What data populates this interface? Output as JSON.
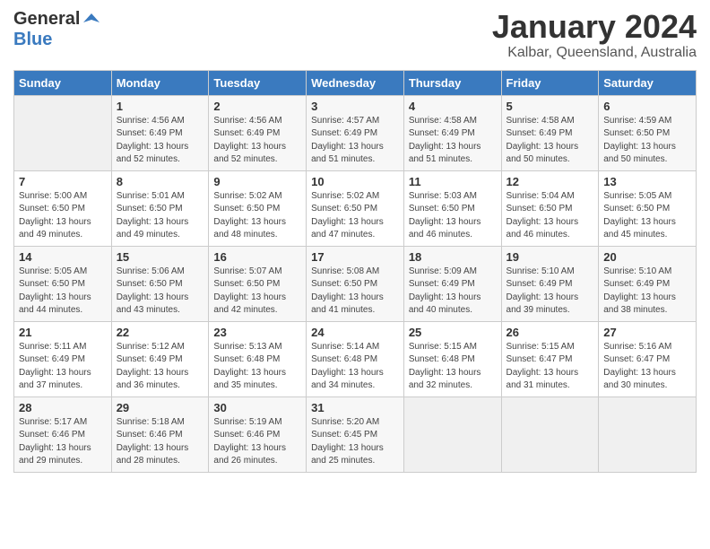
{
  "logo": {
    "general": "General",
    "blue": "Blue"
  },
  "title": "January 2024",
  "subtitle": "Kalbar, Queensland, Australia",
  "days_of_week": [
    "Sunday",
    "Monday",
    "Tuesday",
    "Wednesday",
    "Thursday",
    "Friday",
    "Saturday"
  ],
  "weeks": [
    [
      {
        "day": "",
        "detail": ""
      },
      {
        "day": "1",
        "detail": "Sunrise: 4:56 AM\nSunset: 6:49 PM\nDaylight: 13 hours\nand 52 minutes."
      },
      {
        "day": "2",
        "detail": "Sunrise: 4:56 AM\nSunset: 6:49 PM\nDaylight: 13 hours\nand 52 minutes."
      },
      {
        "day": "3",
        "detail": "Sunrise: 4:57 AM\nSunset: 6:49 PM\nDaylight: 13 hours\nand 51 minutes."
      },
      {
        "day": "4",
        "detail": "Sunrise: 4:58 AM\nSunset: 6:49 PM\nDaylight: 13 hours\nand 51 minutes."
      },
      {
        "day": "5",
        "detail": "Sunrise: 4:58 AM\nSunset: 6:49 PM\nDaylight: 13 hours\nand 50 minutes."
      },
      {
        "day": "6",
        "detail": "Sunrise: 4:59 AM\nSunset: 6:50 PM\nDaylight: 13 hours\nand 50 minutes."
      }
    ],
    [
      {
        "day": "7",
        "detail": "Sunrise: 5:00 AM\nSunset: 6:50 PM\nDaylight: 13 hours\nand 49 minutes."
      },
      {
        "day": "8",
        "detail": "Sunrise: 5:01 AM\nSunset: 6:50 PM\nDaylight: 13 hours\nand 49 minutes."
      },
      {
        "day": "9",
        "detail": "Sunrise: 5:02 AM\nSunset: 6:50 PM\nDaylight: 13 hours\nand 48 minutes."
      },
      {
        "day": "10",
        "detail": "Sunrise: 5:02 AM\nSunset: 6:50 PM\nDaylight: 13 hours\nand 47 minutes."
      },
      {
        "day": "11",
        "detail": "Sunrise: 5:03 AM\nSunset: 6:50 PM\nDaylight: 13 hours\nand 46 minutes."
      },
      {
        "day": "12",
        "detail": "Sunrise: 5:04 AM\nSunset: 6:50 PM\nDaylight: 13 hours\nand 46 minutes."
      },
      {
        "day": "13",
        "detail": "Sunrise: 5:05 AM\nSunset: 6:50 PM\nDaylight: 13 hours\nand 45 minutes."
      }
    ],
    [
      {
        "day": "14",
        "detail": "Sunrise: 5:05 AM\nSunset: 6:50 PM\nDaylight: 13 hours\nand 44 minutes."
      },
      {
        "day": "15",
        "detail": "Sunrise: 5:06 AM\nSunset: 6:50 PM\nDaylight: 13 hours\nand 43 minutes."
      },
      {
        "day": "16",
        "detail": "Sunrise: 5:07 AM\nSunset: 6:50 PM\nDaylight: 13 hours\nand 42 minutes."
      },
      {
        "day": "17",
        "detail": "Sunrise: 5:08 AM\nSunset: 6:50 PM\nDaylight: 13 hours\nand 41 minutes."
      },
      {
        "day": "18",
        "detail": "Sunrise: 5:09 AM\nSunset: 6:49 PM\nDaylight: 13 hours\nand 40 minutes."
      },
      {
        "day": "19",
        "detail": "Sunrise: 5:10 AM\nSunset: 6:49 PM\nDaylight: 13 hours\nand 39 minutes."
      },
      {
        "day": "20",
        "detail": "Sunrise: 5:10 AM\nSunset: 6:49 PM\nDaylight: 13 hours\nand 38 minutes."
      }
    ],
    [
      {
        "day": "21",
        "detail": "Sunrise: 5:11 AM\nSunset: 6:49 PM\nDaylight: 13 hours\nand 37 minutes."
      },
      {
        "day": "22",
        "detail": "Sunrise: 5:12 AM\nSunset: 6:49 PM\nDaylight: 13 hours\nand 36 minutes."
      },
      {
        "day": "23",
        "detail": "Sunrise: 5:13 AM\nSunset: 6:48 PM\nDaylight: 13 hours\nand 35 minutes."
      },
      {
        "day": "24",
        "detail": "Sunrise: 5:14 AM\nSunset: 6:48 PM\nDaylight: 13 hours\nand 34 minutes."
      },
      {
        "day": "25",
        "detail": "Sunrise: 5:15 AM\nSunset: 6:48 PM\nDaylight: 13 hours\nand 32 minutes."
      },
      {
        "day": "26",
        "detail": "Sunrise: 5:15 AM\nSunset: 6:47 PM\nDaylight: 13 hours\nand 31 minutes."
      },
      {
        "day": "27",
        "detail": "Sunrise: 5:16 AM\nSunset: 6:47 PM\nDaylight: 13 hours\nand 30 minutes."
      }
    ],
    [
      {
        "day": "28",
        "detail": "Sunrise: 5:17 AM\nSunset: 6:46 PM\nDaylight: 13 hours\nand 29 minutes."
      },
      {
        "day": "29",
        "detail": "Sunrise: 5:18 AM\nSunset: 6:46 PM\nDaylight: 13 hours\nand 28 minutes."
      },
      {
        "day": "30",
        "detail": "Sunrise: 5:19 AM\nSunset: 6:46 PM\nDaylight: 13 hours\nand 26 minutes."
      },
      {
        "day": "31",
        "detail": "Sunrise: 5:20 AM\nSunset: 6:45 PM\nDaylight: 13 hours\nand 25 minutes."
      },
      {
        "day": "",
        "detail": ""
      },
      {
        "day": "",
        "detail": ""
      },
      {
        "day": "",
        "detail": ""
      }
    ]
  ]
}
